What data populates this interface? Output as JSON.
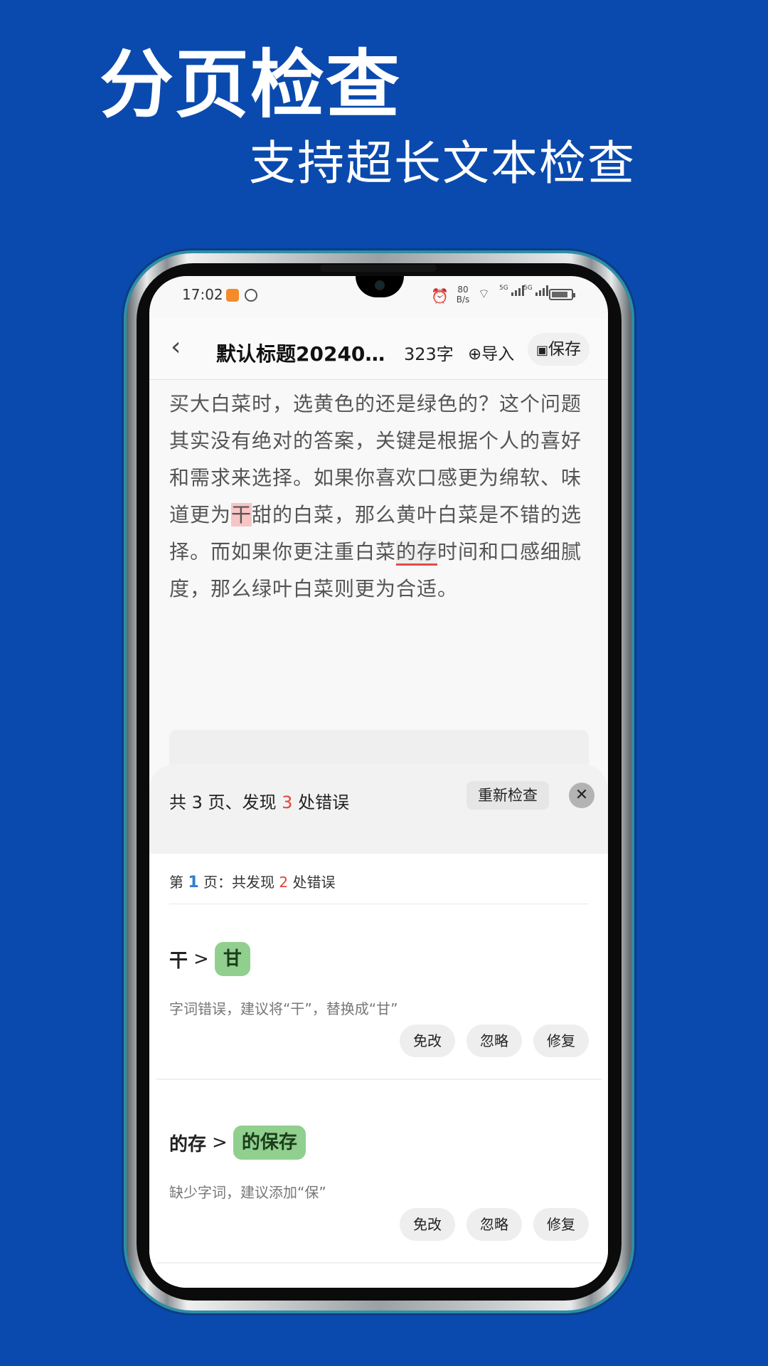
{
  "banner": {
    "headline": "分页检查",
    "subline": "支持超长文本检查"
  },
  "status_bar": {
    "time": "17:02",
    "net_speed_value": "80",
    "net_speed_unit": "B/s",
    "sig1_label": "5G",
    "sig2_label": "5G"
  },
  "header": {
    "back_icon": "chevron-left",
    "title": "默认标题20240…",
    "word_count": "323字",
    "import_label": "导入",
    "save_label": "保存"
  },
  "content": {
    "part1": "买大白菜时，选黄色的还是绿色的？这个问题其实没有绝对的答案，关键是根据个人的喜好和需求来选择。如果你喜欢口感更为绵软、味道更为",
    "error1": "干",
    "part2": "甜的白菜，那么黄叶白菜是不错的选择。而如果你更注重白菜",
    "error2": "的存",
    "part3": "时间和口感细腻度，那么绿叶白菜则更为合适。"
  },
  "sheet": {
    "summary_prefix": "共 3  页、发现",
    "summary_errors": "3",
    "summary_suffix": "处错误",
    "recheck_label": "重新检查",
    "page_prefix": "第",
    "page_number": "1",
    "page_mid": "页：共发现",
    "page_errors": "2",
    "page_suffix": "处错误",
    "items": [
      {
        "from": "干",
        "arrow": ">",
        "to": "甘",
        "desc": "字词错误，建议将“干”，替换成“甘”",
        "btn_exempt": "免改",
        "btn_ignore": "忽略",
        "btn_fix": "修复"
      },
      {
        "from": "的存",
        "arrow": ">",
        "to": "的保存",
        "desc": "缺少字词，建议添加“保”",
        "btn_exempt": "免改",
        "btn_ignore": "忽略",
        "btn_fix": "修复"
      }
    ]
  },
  "colors": {
    "background": "#0a4aae",
    "error_red": "#e0463a",
    "highlight_red": "#f8c5c5",
    "suggestion_green": "#91cf8f",
    "page_blue": "#2d7ed1"
  }
}
